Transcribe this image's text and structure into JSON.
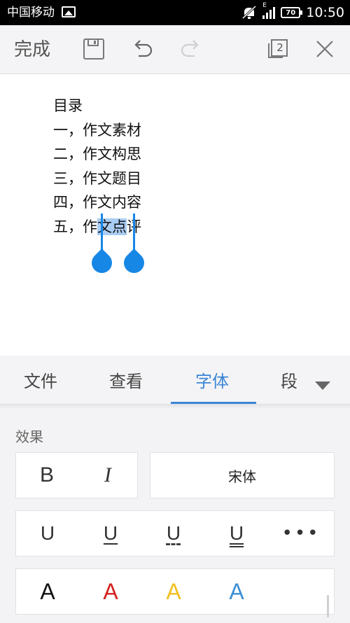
{
  "status_bar": {
    "carrier": "中国移动",
    "network_badge": "E",
    "battery_level": "70",
    "time": "10:50"
  },
  "toolbar": {
    "done_label": "完成",
    "page_count": "2",
    "icons": [
      "save-icon",
      "undo-icon",
      "redo-icon",
      "pages-icon",
      "close-icon"
    ]
  },
  "document": {
    "lines": [
      {
        "text": "目录"
      },
      {
        "text": "一，作文素材"
      },
      {
        "text": "二，作文构思"
      },
      {
        "text": "三，作文题目"
      },
      {
        "text": "四，作文内容"
      },
      {
        "before": "五，作",
        "selected": "文点",
        "after": "评"
      }
    ],
    "selection_color": "#a9cdf2",
    "handle_color": "#1787e6"
  },
  "tabs": {
    "items": [
      "文件",
      "查看",
      "字体",
      "段"
    ],
    "active": "字体",
    "accent": "#3b86d6"
  },
  "font_panel": {
    "section_label": "效果",
    "bold": "B",
    "italic": "I",
    "font_name": "宋体",
    "underline_glyph": "U",
    "more": "•••",
    "color_glyph": "A",
    "colors": [
      "#111111",
      "#d42020",
      "#f0c01e",
      "#3d8fd6"
    ]
  }
}
